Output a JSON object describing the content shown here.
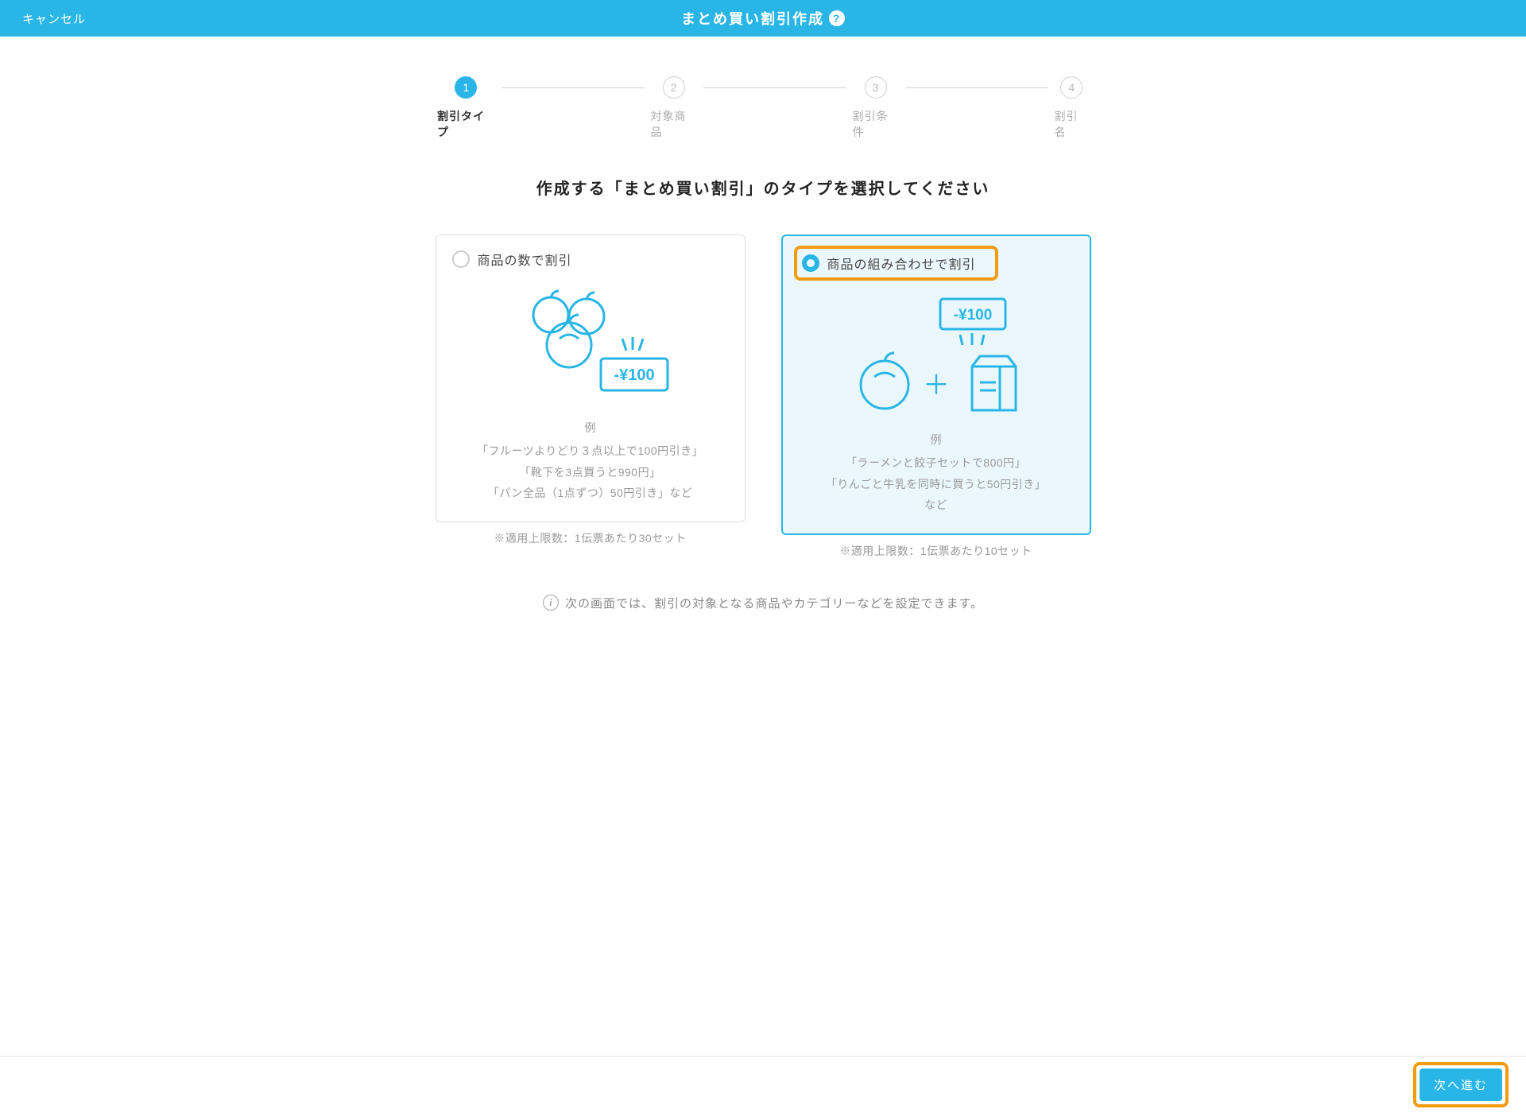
{
  "header": {
    "cancel": "キャンセル",
    "title": "まとめ買い割引作成",
    "help_glyph": "?"
  },
  "stepper": {
    "steps": [
      {
        "num": "1",
        "label": "割引タイプ",
        "active": true
      },
      {
        "num": "2",
        "label": "対象商品",
        "active": false
      },
      {
        "num": "3",
        "label": "割引条件",
        "active": false
      },
      {
        "num": "4",
        "label": "割引名",
        "active": false
      }
    ]
  },
  "instruction": "作成する「まとめ買い割引」のタイプを選択してください",
  "options": {
    "quantity": {
      "title": "商品の数で割引",
      "price_tag": "-¥100",
      "example_label": "例",
      "example_line1": "「フルーツよりどり３点以上で100円引き」",
      "example_line2": "「靴下を3点買うと990円」",
      "example_line3": "「パン全品（1点ずつ）50円引き」など",
      "limit": "※適用上限数：1伝票あたり30セット"
    },
    "combination": {
      "title": "商品の組み合わせで割引",
      "price_tag": "-¥100",
      "plus_glyph": "＋",
      "example_label": "例",
      "example_line1": "「ラーメンと餃子セットで800円」",
      "example_line2": "「りんごと牛乳を同時に買うと50円引き」",
      "example_line3": "など",
      "limit": "※適用上限数：1伝票あたり10セット"
    }
  },
  "info": {
    "glyph": "i",
    "text": "次の画面では、割引の対象となる商品やカテゴリーなどを設定できます。"
  },
  "footer": {
    "next": "次へ進む"
  }
}
